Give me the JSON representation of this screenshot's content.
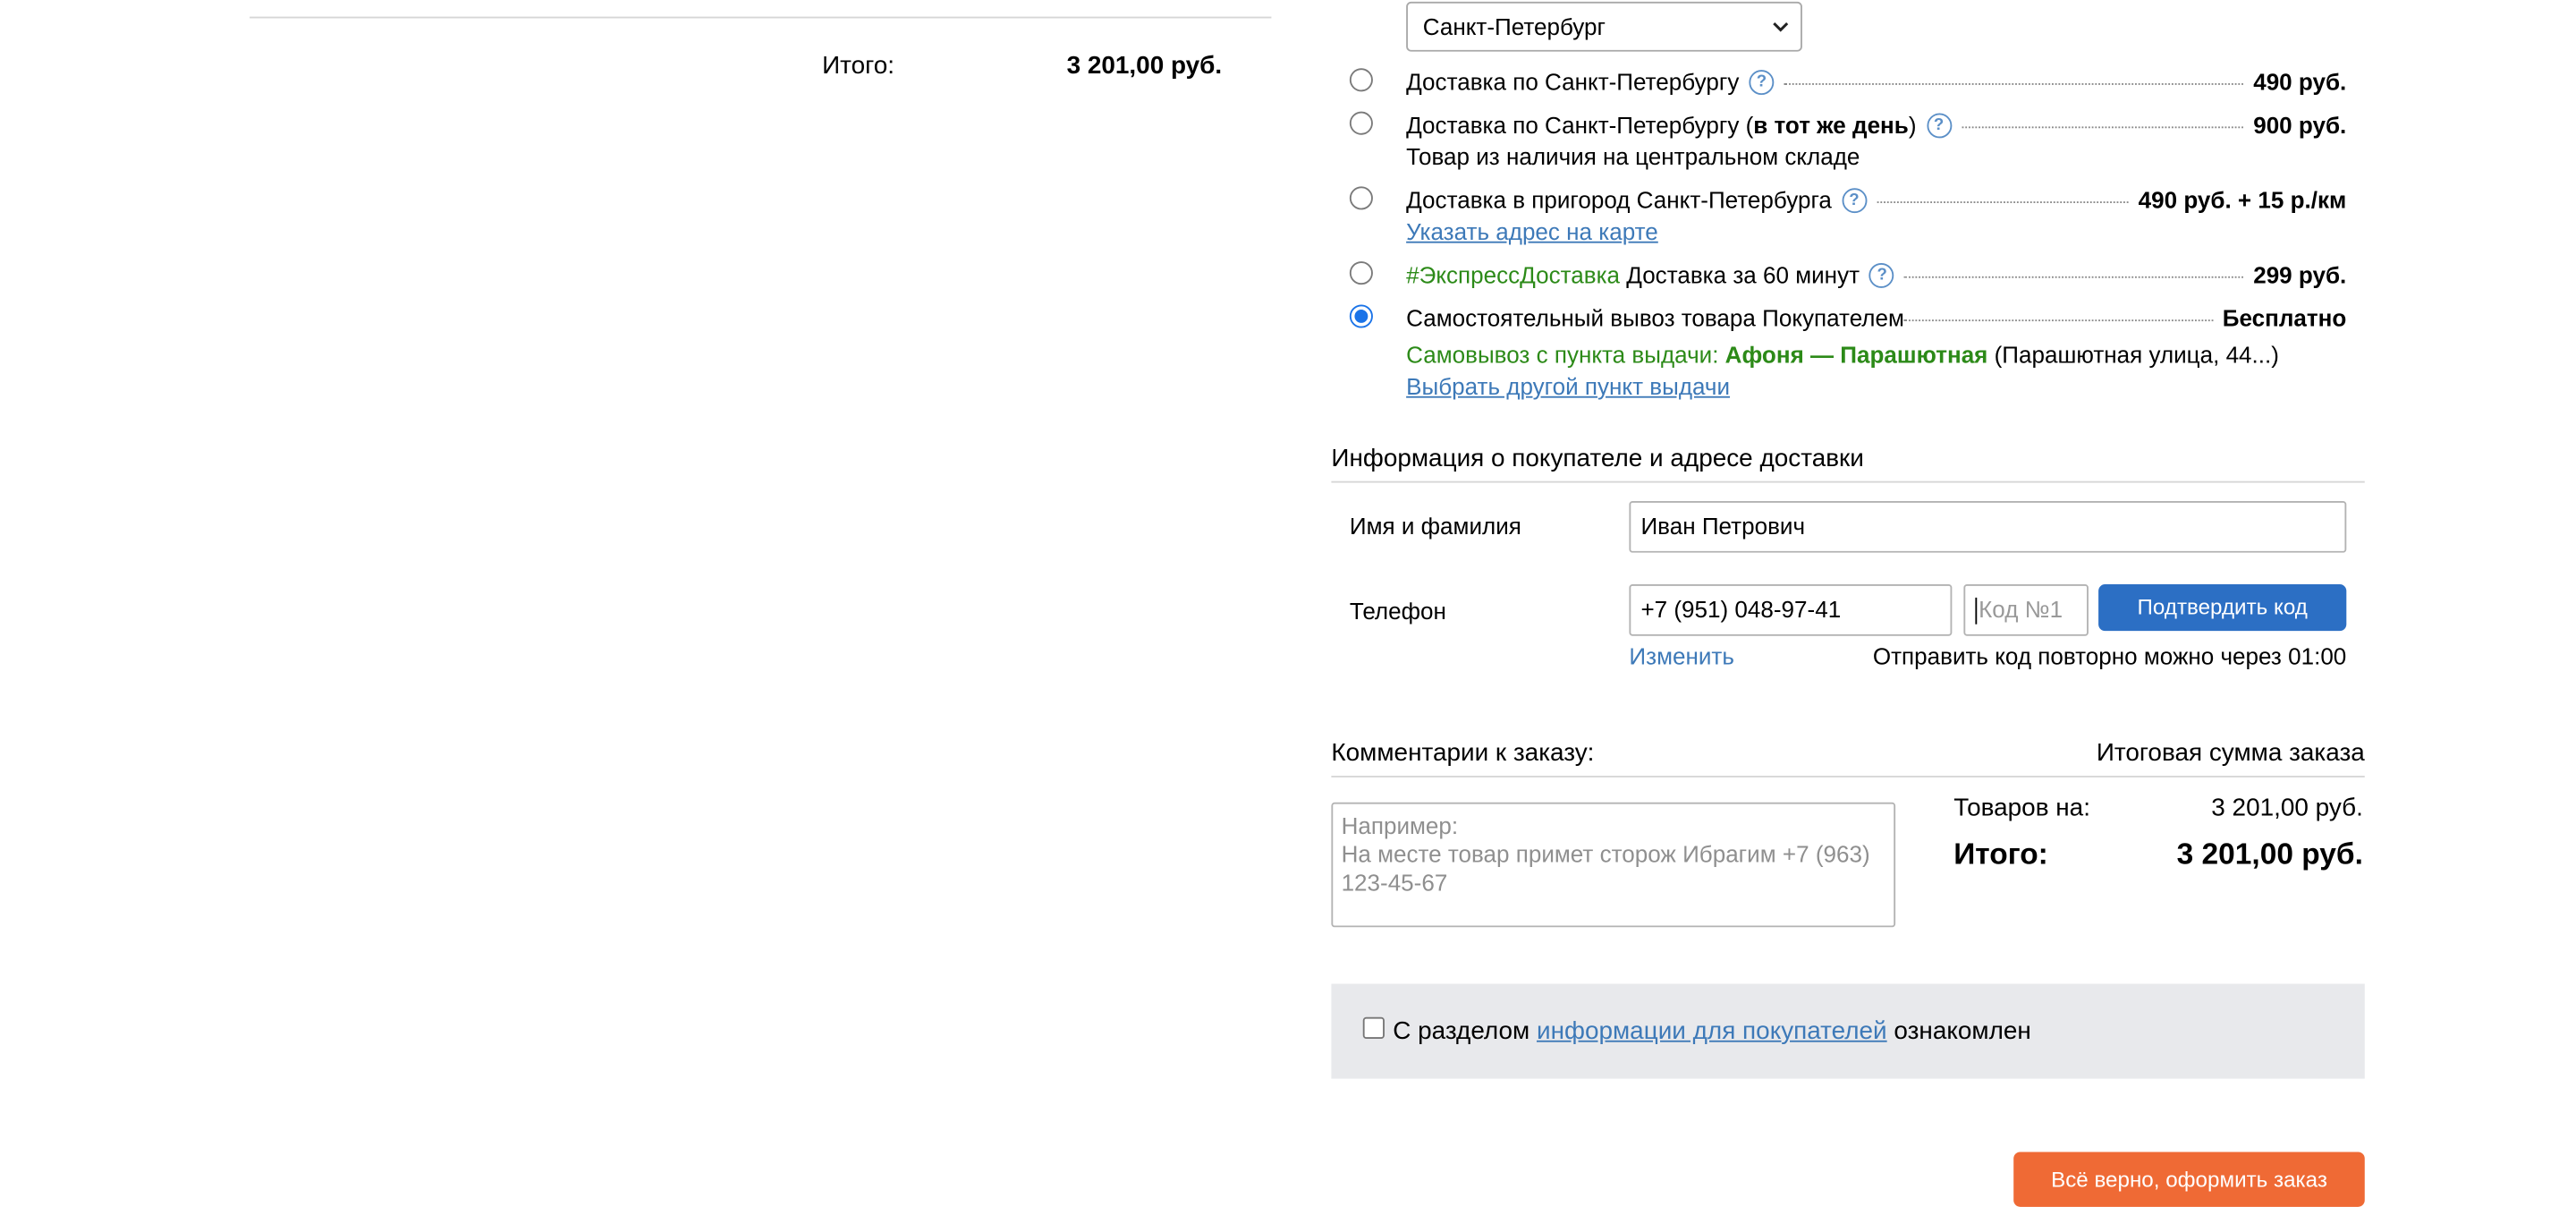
{
  "summary_left": {
    "total_label": "Итого:",
    "total_value": "3 201,00 руб."
  },
  "city_select": {
    "value": "Санкт-Петербург"
  },
  "delivery_options": [
    {
      "label": "Доставка по Санкт-Петербургу",
      "price": "490 руб.",
      "checked": false
    },
    {
      "label": "Доставка по Санкт-Петербургу (",
      "label_bold": "в тот же день",
      "label_end": ")",
      "price": "900 руб.",
      "note": "Товар из наличия на центральном складе",
      "checked": false
    },
    {
      "label": "Доставка в пригород Санкт-Петербурга",
      "price": "490 руб. + 15 р./км",
      "link": "Указать адрес на карте",
      "checked": false
    },
    {
      "tag": "#ЭкспрессДоставка",
      "label": " Доставка за 60 минут",
      "price": "299 руб.",
      "checked": false
    },
    {
      "label": "Самостоятельный вывоз товара Покупателем",
      "price": "Бесплатно",
      "pickup_prefix": "Самовывоз с пункта выдачи: ",
      "pickup_point": "Афоня — Парашютная",
      "pickup_address": " (Парашютная улица, 44...)",
      "link": "Выбрать другой пункт выдачи",
      "checked": true
    }
  ],
  "buyer": {
    "section_title": "Информация о покупателе и адресе доставки",
    "name_label": "Имя и фамилия",
    "name_value": "Иван Петрович",
    "phone_label": "Телефон",
    "phone_value": "+7 (951) 048-97-41",
    "code_placeholder": "Код №1",
    "confirm_button": "Подтвердить код",
    "change_link": "Изменить",
    "resend_text": "Отправить код повторно можно через 01:00"
  },
  "comments": {
    "title": "Комментарии к заказу:",
    "placeholder": "Например:\nНа месте товар примет сторож Ибрагим +7 (963) 123-45-67"
  },
  "order_total": {
    "title": "Итоговая сумма заказа",
    "goods_label": "Товаров на:",
    "goods_value": "3 201,00 руб.",
    "total_label": "Итого:",
    "total_value": "3 201,00 руб."
  },
  "agreement": {
    "text_before": "С разделом ",
    "link": "информации для покупателей",
    "text_after": " ознакомлен"
  },
  "submit_button": "Всё верно, оформить заказ"
}
